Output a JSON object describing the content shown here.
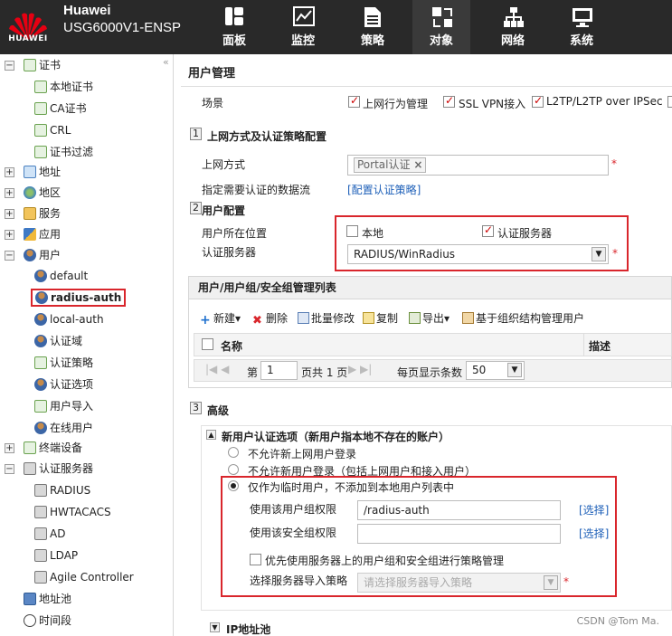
{
  "header": {
    "logo_text": "HUAWEI",
    "brand": "Huawei",
    "product": "USG6000V1-ENSP",
    "nav": [
      {
        "label": "面板",
        "icon": "dashboard-icon"
      },
      {
        "label": "监控",
        "icon": "monitor-chart-icon"
      },
      {
        "label": "策略",
        "icon": "policy-doc-icon"
      },
      {
        "label": "对象",
        "icon": "objects-icon"
      },
      {
        "label": "网络",
        "icon": "network-icon"
      },
      {
        "label": "系统",
        "icon": "system-icon"
      }
    ],
    "active_nav": "对象"
  },
  "sidebar": {
    "collapse_glyph": "«",
    "items": [
      {
        "label": "证书",
        "toggle": "−"
      },
      {
        "label": "本地证书"
      },
      {
        "label": "CA证书"
      },
      {
        "label": "CRL"
      },
      {
        "label": "证书过滤"
      },
      {
        "label": "地址",
        "toggle": "+"
      },
      {
        "label": "地区",
        "toggle": "+"
      },
      {
        "label": "服务",
        "toggle": "+"
      },
      {
        "label": "应用",
        "toggle": "+"
      },
      {
        "label": "用户",
        "toggle": "−"
      },
      {
        "label": "default"
      },
      {
        "label": "radius-auth"
      },
      {
        "label": "local-auth"
      },
      {
        "label": "认证域"
      },
      {
        "label": "认证策略"
      },
      {
        "label": "认证选项"
      },
      {
        "label": "用户导入"
      },
      {
        "label": "在线用户"
      },
      {
        "label": "终端设备",
        "toggle": "+"
      },
      {
        "label": "认证服务器",
        "toggle": "−"
      },
      {
        "label": "RADIUS"
      },
      {
        "label": "HWTACACS"
      },
      {
        "label": "AD"
      },
      {
        "label": "LDAP"
      },
      {
        "label": "Agile Controller"
      },
      {
        "label": "地址池"
      },
      {
        "label": "时间段"
      }
    ]
  },
  "main": {
    "title": "用户管理",
    "scene_label": "场景",
    "scene_options": [
      "上网行为管理",
      "SSL VPN接入",
      "L2TP/L2TP over IPSec"
    ],
    "section1": {
      "num": "1",
      "title": "上网方式及认证策略配置"
    },
    "access_label": "上网方式",
    "access_tag": "Portal认证",
    "access_tag_close": "×",
    "flow_label": "指定需要认证的数据流",
    "flow_link": "[配置认证策略]",
    "section2": {
      "num": "2",
      "title": "用户配置"
    },
    "location_label": "用户所在位置",
    "location_local": "本地",
    "location_server": "认证服务器",
    "server_label": "认证服务器",
    "server_value": "RADIUS/WinRadius",
    "required_mark": "*",
    "list_title": "用户/用户组/安全组管理列表",
    "toolbar": {
      "new": "新建",
      "delete": "删除",
      "batch_edit": "批量修改",
      "copy": "复制",
      "export": "导出",
      "org_manage": "基于组织结构管理用户"
    },
    "grid": {
      "col_name": "名称",
      "col_desc": "描述"
    },
    "pager": {
      "page_prefix": "第",
      "page_value": "1",
      "page_suffix": "页共 1 页",
      "per_page_label": "每页显示条数",
      "per_page_value": "50"
    },
    "section3": {
      "num": "3",
      "title": "高级"
    },
    "new_user_options_title": "新用户认证选项（新用户指本地不存在的账户）",
    "radio_options": [
      "不允许新上网用户登录",
      "不允许新用户登录（包括上网用户和接入用户）",
      "仅作为临时用户，不添加到本地用户列表中"
    ],
    "use_group_label": "使用该用户组权限",
    "use_group_value": "/radius-auth",
    "use_sec_label": "使用该安全组权限",
    "use_sec_value": "",
    "select_link": "[选择]",
    "prefer_server_label": "优先使用服务器上的用户组和安全组进行策略管理",
    "import_policy_label": "选择服务器导入策略",
    "import_policy_placeholder": "请选择服务器导入策略",
    "ip_pool_title": "IP地址池"
  },
  "watermark": "CSDN @Tom Ma."
}
